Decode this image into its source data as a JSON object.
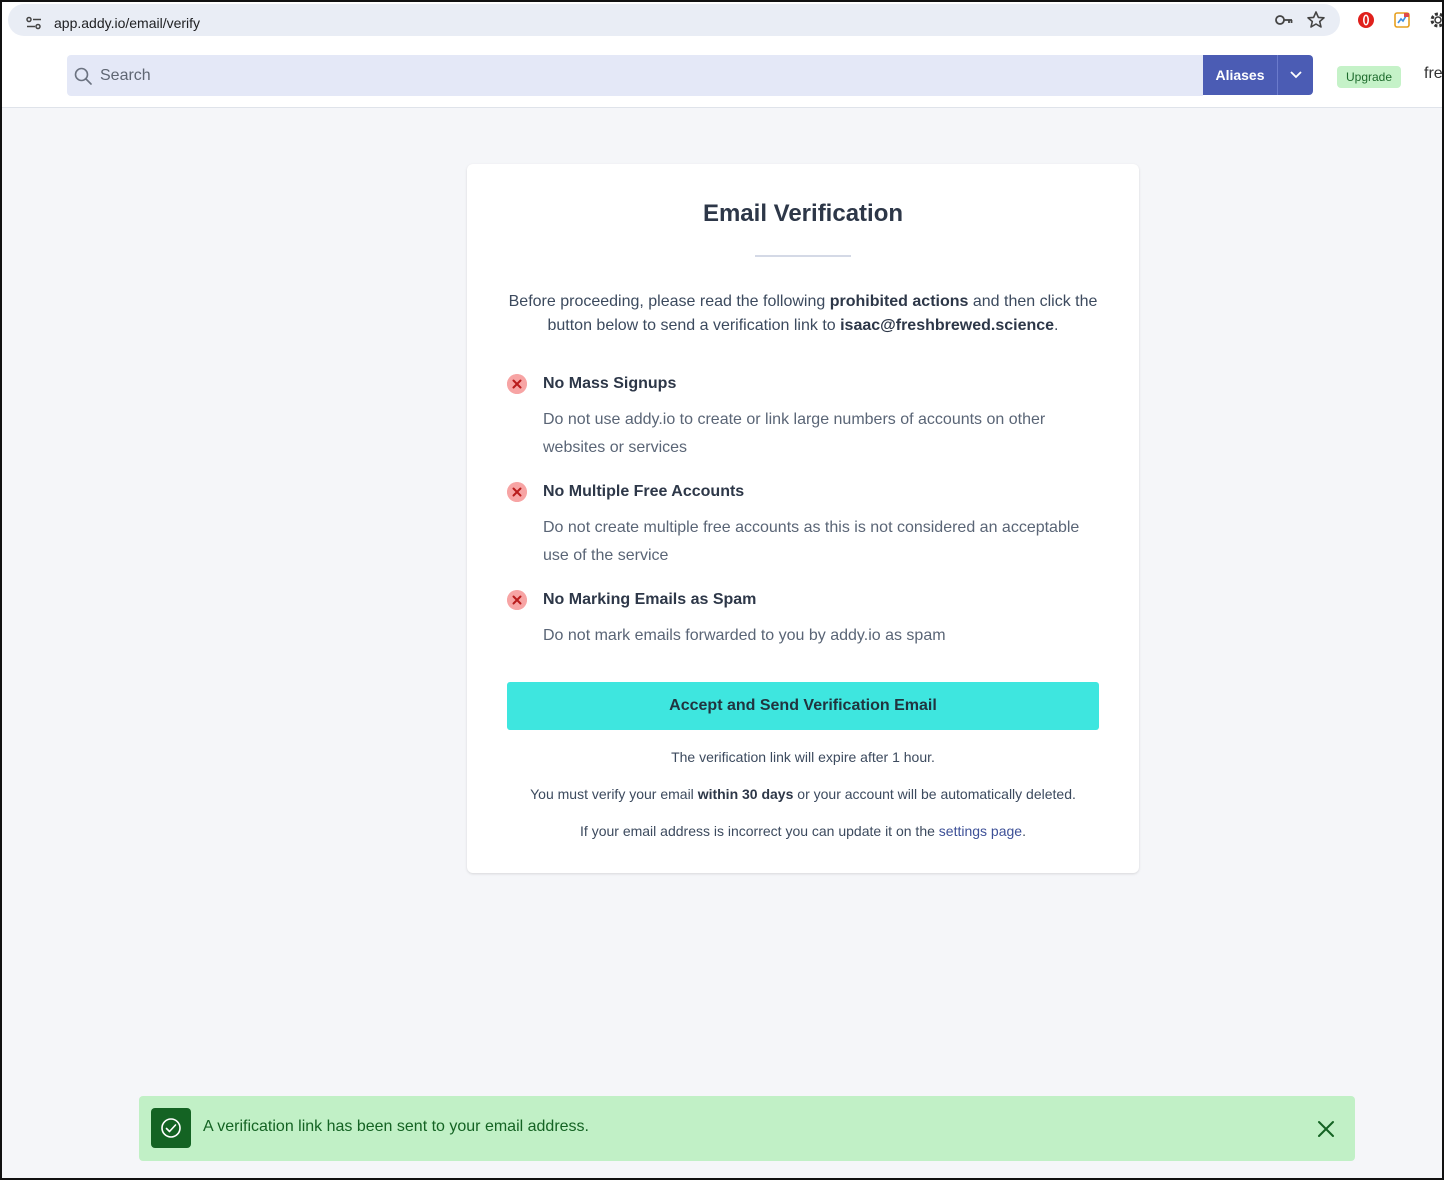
{
  "browser": {
    "url": "app.addy.io/email/verify",
    "icons": [
      "site-info-icon",
      "key-icon",
      "star-icon",
      "extension-red-icon",
      "extension-color-icon",
      "settings-gear-icon"
    ]
  },
  "header": {
    "search_placeholder": "Search",
    "aliases_label": "Aliases",
    "upgrade_label": "Upgrade",
    "user_label_partial": "fre"
  },
  "card": {
    "title": "Email Verification",
    "intro_before": "Before proceeding, please read the following ",
    "intro_bold": "prohibited actions",
    "intro_middle": " and then click the button below to send a verification link to ",
    "intro_email": "isaac@freshbrewed.science",
    "intro_end": ".",
    "rules": [
      {
        "title": "No Mass Signups",
        "desc": "Do not use addy.io to create or link large numbers of accounts on other websites or services"
      },
      {
        "title": "No Multiple Free Accounts",
        "desc": "Do not create multiple free accounts as this is not considered an acceptable use of the service"
      },
      {
        "title": "No Marking Emails as Spam",
        "desc": "Do not mark emails forwarded to you by addy.io as spam"
      }
    ],
    "button_label": "Accept and Send Verification Email",
    "expire_note": "The verification link will expire after 1 hour.",
    "verify_note_before": "You must verify your email ",
    "verify_note_bold": "within 30 days",
    "verify_note_after": " or your account will be automatically deleted.",
    "settings_note_before": "If your email address is incorrect you can update it on the ",
    "settings_link": "settings page",
    "settings_note_after": "."
  },
  "toast": {
    "message": "A verification link has been sent to your email address.",
    "color_bg": "#c1f0c6",
    "color_fg": "#146323"
  },
  "colors": {
    "accent_button": "#3ee6df",
    "aliases_button": "#4b5cb4",
    "error_icon": "#f7a4a4"
  }
}
